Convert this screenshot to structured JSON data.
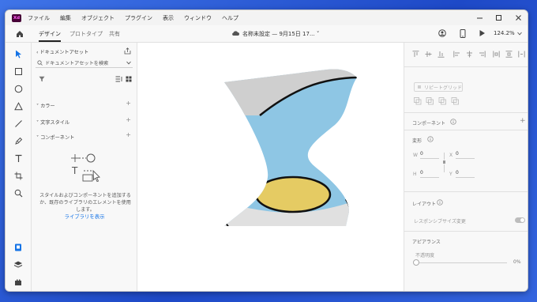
{
  "app": {
    "logo_text": "Xd",
    "brand_color": "#470137",
    "accent_color": "#1473e6"
  },
  "menu": {
    "items": [
      "ファイル",
      "編集",
      "オブジェクト",
      "プラグイン",
      "表示",
      "ウィンドウ",
      "ヘルプ"
    ]
  },
  "toolbar": {
    "tabs": [
      {
        "label": "デザイン",
        "active": true
      },
      {
        "label": "プロトタイプ",
        "active": false
      },
      {
        "label": "共有",
        "active": false
      }
    ],
    "doc_title": "名称未設定 — 9月15日 17... ˅",
    "zoom": "124.2%"
  },
  "assets_panel": {
    "title": "ドキュメントアセット",
    "search_placeholder": "ドキュメントアセットを検索",
    "sections": [
      "カラー",
      "文字スタイル",
      "コンポーネント"
    ],
    "empty_text": "スタイルおよびコンポーネントを追加するか、既存のライブラリのエレメントを使用します。",
    "library_link": "ライブラリを表示"
  },
  "properties_panel": {
    "repeat_grid": "リピートグリッド",
    "component_label": "コンポーネント",
    "transform_label": "変形",
    "w_label": "W",
    "w_value": "0",
    "x_label": "X",
    "x_value": "0",
    "h_label": "H",
    "h_value": "0",
    "y_label": "Y",
    "y_value": "0",
    "layout_label": "レイアウト",
    "responsive_label": "レスポンシブサイズ変更",
    "appearance_label": "アピアランス",
    "opacity_label": "不透明度",
    "opacity_value": "0%"
  },
  "artwork": {
    "colors": {
      "blue": "#8ec6e4",
      "gray": "#cfcfcf",
      "light_gray": "#e0e0e0",
      "yellow": "#e5cb63",
      "stroke": "#111111"
    }
  }
}
